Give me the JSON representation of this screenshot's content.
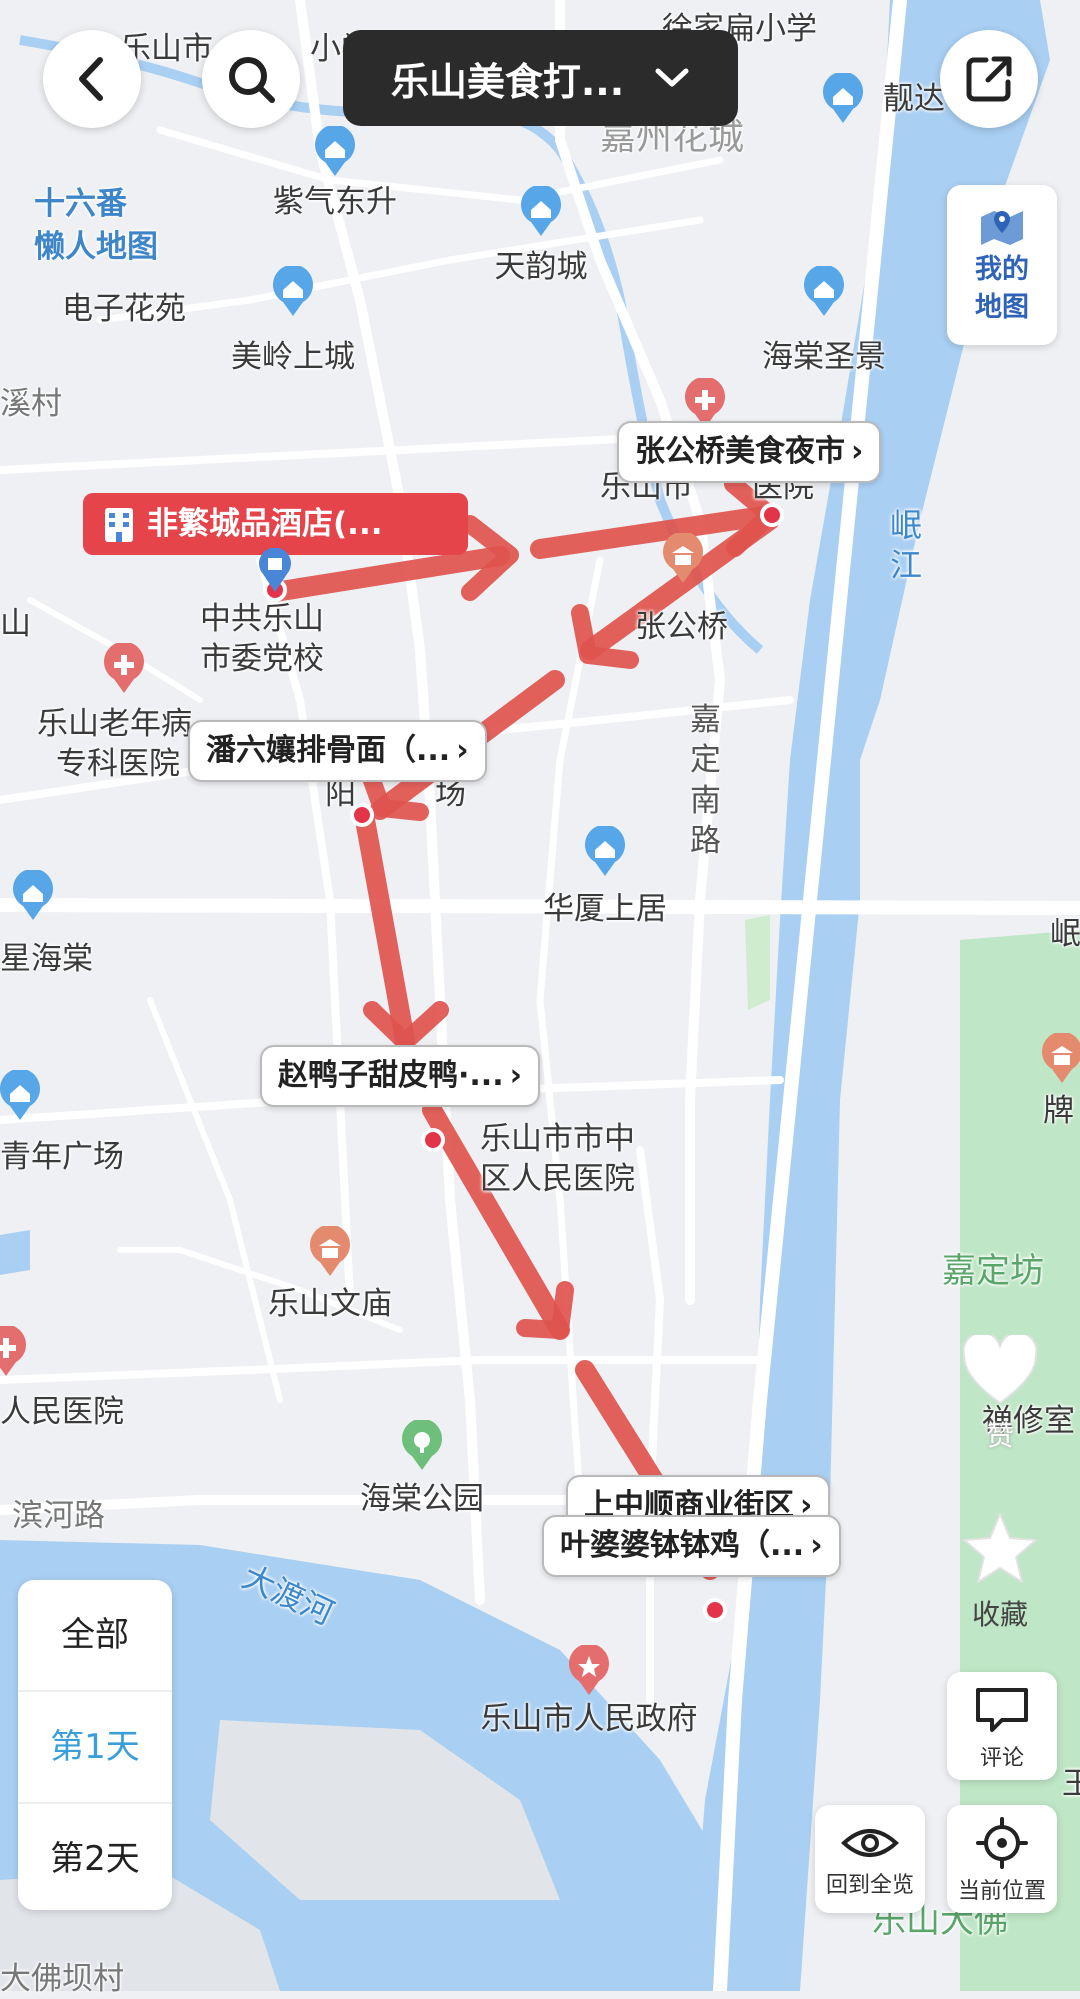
{
  "header": {
    "title": "乐山美食打...",
    "back_icon": "chevron-left-icon",
    "search_icon": "search-icon",
    "share_icon": "external-link-icon"
  },
  "my_map": {
    "label_line1": "我的",
    "label_line2": "地图"
  },
  "route": {
    "color": "#e0544e",
    "hotel": "非繁城品酒店(...",
    "stops": [
      "张公桥美食夜市",
      "潘六孃排骨面（...",
      "赵鸭子甜皮鸭·...",
      "上中顺商业街区",
      "叶婆婆钵钵鸡（..."
    ]
  },
  "places": {
    "p1": "乐山市",
    "p1b": "小学",
    "p2": "徐家扁小学",
    "p3": "靓达",
    "p4": "嘉州花城",
    "p5": "紫气东升",
    "p6a": "十六番",
    "p6b": "懒人地图",
    "p7": "天韵城",
    "p8": "电子花苑",
    "p9": "美岭上城",
    "p10": "海棠圣景",
    "p11": "溪村",
    "p12": "乐山市",
    "p12b": "医院",
    "p13a": "中共乐山",
    "p13b": "市委党校",
    "p14": "张公桥",
    "p15a": "乐山老年病",
    "p15b": "专科医院",
    "p16": "阳",
    "p16b": "场",
    "p17": "华厦上居",
    "p18": "星海棠",
    "p19": "青年广场",
    "p20a": "乐山市市中",
    "p20b": "区人民医院",
    "p21": "乐山文庙",
    "p22": "嘉定坊",
    "p23": "牌",
    "p24": "人民医院",
    "p25": "滨河路",
    "p26": "海棠公园",
    "p27": "禅修室",
    "p28": "乐山市人民政府",
    "p29": "大佛坝村",
    "p30": "乐山大佛",
    "p31": "山",
    "p32": "岷",
    "p33": "王",
    "road1": "嘉定南路",
    "river1": "岷江",
    "river2": "大渡河"
  },
  "actions": {
    "like": "赞",
    "favorite": "收藏",
    "comment": "评论",
    "overview": "回到全览",
    "locate": "当前位置"
  },
  "days": [
    "全部",
    "第1天",
    "第2天"
  ]
}
